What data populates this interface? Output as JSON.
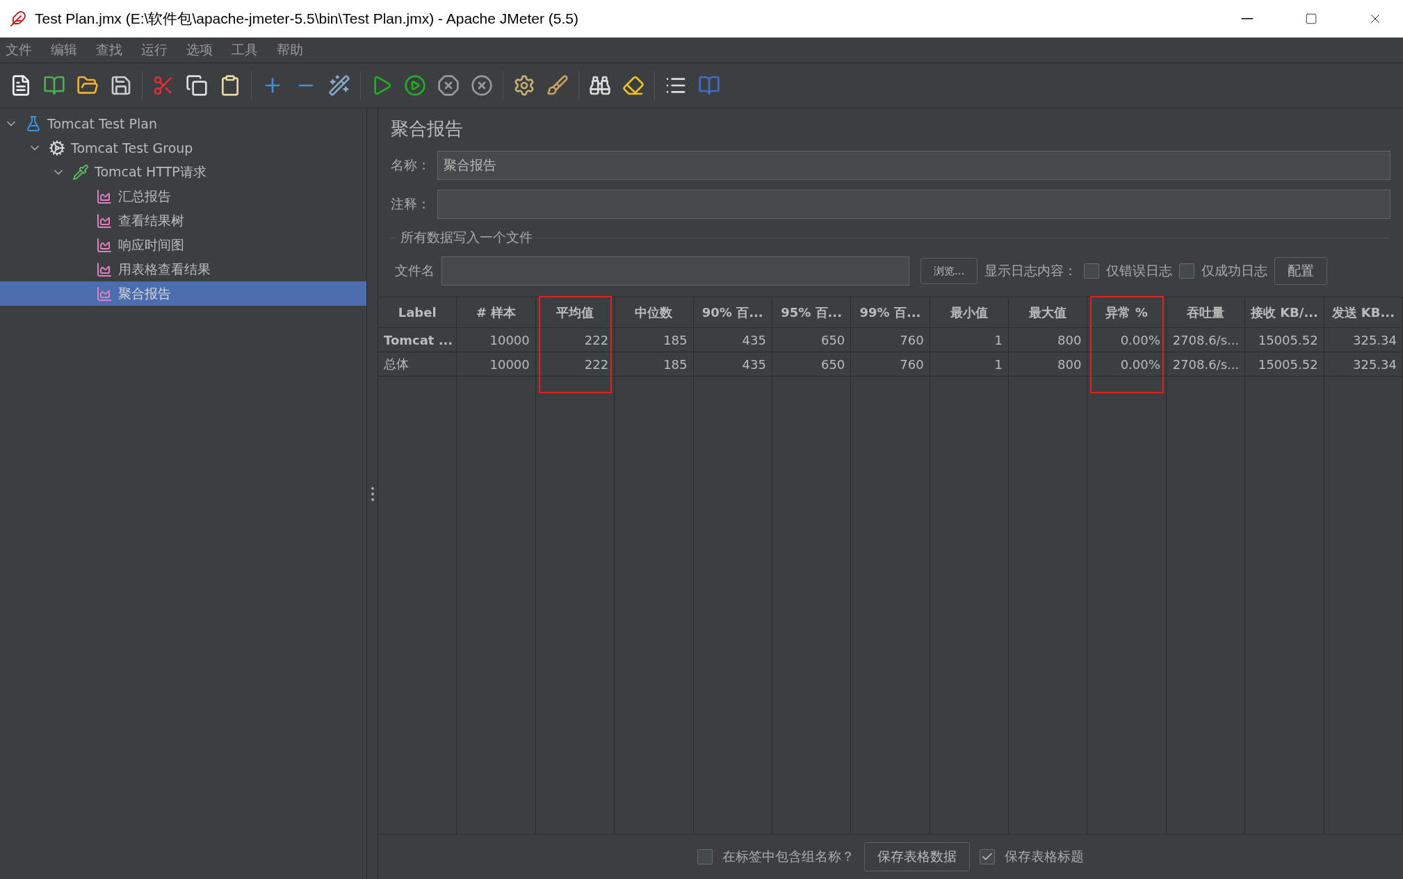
{
  "window": {
    "title": "Test Plan.jmx (E:\\软件包\\apache-jmeter-5.5\\bin\\Test Plan.jmx) - Apache JMeter (5.5)"
  },
  "menu": [
    "文件",
    "编辑",
    "查找",
    "运行",
    "选项",
    "工具",
    "帮助"
  ],
  "tree": [
    {
      "label": "Tomcat Test Plan",
      "kind": "plan",
      "expanded": true,
      "selected": false,
      "children": [
        {
          "label": "Tomcat Test Group",
          "kind": "group",
          "expanded": true,
          "selected": false,
          "children": [
            {
              "label": "Tomcat HTTP请求",
              "kind": "sampler",
              "expanded": true,
              "selected": false,
              "children": [
                {
                  "label": "汇总报告",
                  "kind": "listener",
                  "selected": false
                },
                {
                  "label": "查看结果树",
                  "kind": "listener",
                  "selected": false
                },
                {
                  "label": "响应时间图",
                  "kind": "listener",
                  "selected": false
                },
                {
                  "label": "用表格查看结果",
                  "kind": "listener",
                  "selected": false
                },
                {
                  "label": "聚合报告",
                  "kind": "listener",
                  "selected": true
                }
              ]
            }
          ]
        }
      ]
    }
  ],
  "panel": {
    "title": "聚合报告",
    "name_label": "名称：",
    "name_value": "聚合报告",
    "comment_label": "注释：",
    "file_section": "所有数据写入一个文件",
    "file_label": "文件名",
    "browse_button": "浏览...",
    "log_label": "显示日志内容：",
    "log_options": [
      {
        "label": "仅错误日志",
        "checked": false
      },
      {
        "label": "仅成功日志",
        "checked": false
      }
    ],
    "config_button": "配置"
  },
  "table": {
    "columns": [
      {
        "label": "Label",
        "highlighted": false
      },
      {
        "label": "# 样本",
        "highlighted": false
      },
      {
        "label": "平均值",
        "highlighted": true
      },
      {
        "label": "中位数",
        "highlighted": false
      },
      {
        "label": "90% 百...",
        "highlighted": false
      },
      {
        "label": "95% 百...",
        "highlighted": false
      },
      {
        "label": "99% 百...",
        "highlighted": false
      },
      {
        "label": "最小值",
        "highlighted": false
      },
      {
        "label": "最大值",
        "highlighted": false
      },
      {
        "label": "异常 %",
        "highlighted": true
      },
      {
        "label": "吞吐量",
        "highlighted": false
      },
      {
        "label": "接收 KB/...",
        "highlighted": false
      },
      {
        "label": "发送 KB...",
        "highlighted": false
      }
    ],
    "rows": [
      {
        "kind": "sampler",
        "cells": [
          "Tomcat ...",
          "10000",
          "222",
          "185",
          "435",
          "650",
          "760",
          "1",
          "800",
          "0.00%",
          "2708.6/s...",
          "15005.52",
          "325.34"
        ]
      },
      {
        "kind": "total",
        "cells": [
          "总体",
          "10000",
          "222",
          "185",
          "435",
          "650",
          "760",
          "1",
          "800",
          "0.00%",
          "2708.6/s...",
          "15005.52",
          "325.34"
        ]
      }
    ]
  },
  "footer": {
    "include_group": {
      "label": "在标签中包含组名称？",
      "checked": false
    },
    "save_button": "保存表格数据",
    "save_header": {
      "label": "保存表格标题",
      "checked": true
    }
  }
}
